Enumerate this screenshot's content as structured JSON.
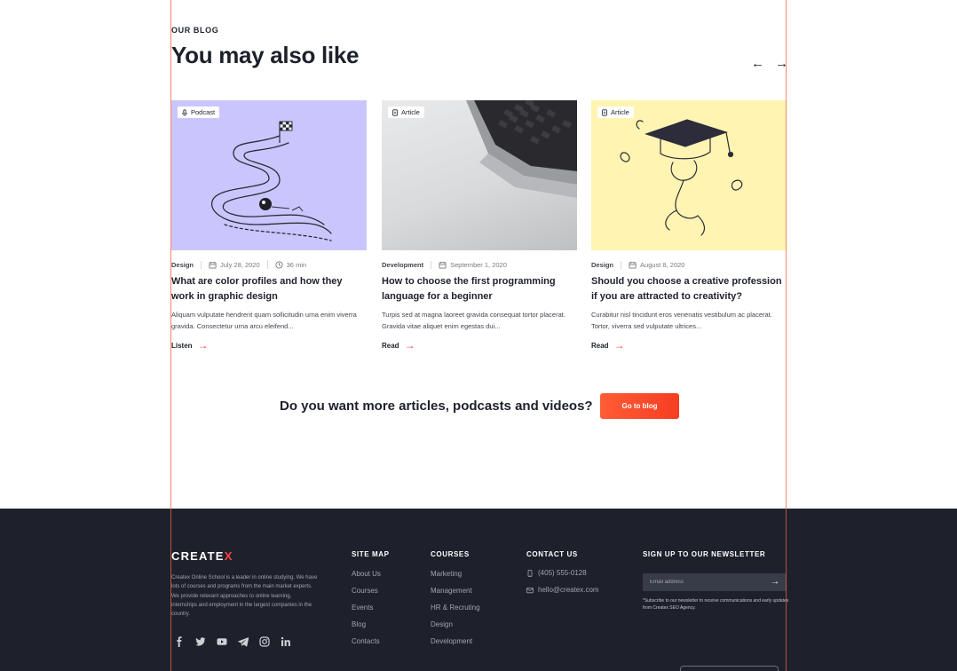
{
  "blog": {
    "eyebrow": "OUR BLOG",
    "heading": "You may also like",
    "prev_icon": "arrow-left-icon",
    "next_icon": "arrow-right-icon"
  },
  "cards": [
    {
      "badge": "Podcast",
      "badge_icon": "microphone-icon",
      "category": "Design",
      "date": "July 28, 2020",
      "duration": "36 min",
      "title": "What are color profiles and how they work in graphic design",
      "excerpt": "Aliquam vulputate hendrerit quam sollicitudin urna enim viverra gravida. Consectetur urna arcu eleifend...",
      "link": "Listen"
    },
    {
      "badge": "Article",
      "badge_icon": "file-icon",
      "category": "Development",
      "date": "September 1, 2020",
      "title": "How to choose the first programming language for a beginner",
      "excerpt": "Turpis sed at magna laoreet gravida consequat tortor placerat. Gravida vitae aliquet enim egestas dui...",
      "link": "Read"
    },
    {
      "badge": "Article",
      "badge_icon": "file-icon",
      "category": "Design",
      "date": "August 8, 2020",
      "title": "Should you choose a creative profession if you are attracted to creativity?",
      "excerpt": "Curabitur nisl tincidunt eros venenatis vestibulum ac placerat. Tortor, viverra sed vulputate ultrices...",
      "link": "Read"
    }
  ],
  "cta": {
    "text": "Do you want more articles, podcasts and videos?",
    "button": "Go to blog"
  },
  "footer": {
    "logo_main": "CREATE",
    "logo_accent": "X",
    "about": "Createx Online School is a leader in online studying. We have lots of courses and programs from the main market experts. We provide relevant approaches to online learning, internships and employment in the largest companies in the country.",
    "socials": [
      "facebook-icon",
      "twitter-icon",
      "youtube-icon",
      "telegram-icon",
      "instagram-icon",
      "linkedin-icon"
    ],
    "sitemap": {
      "title": "SITE MAP",
      "items": [
        "About Us",
        "Courses",
        "Events",
        "Blog",
        "Contacts"
      ]
    },
    "courses": {
      "title": "COURSES",
      "items": [
        "Marketing",
        "Management",
        "HR & Recruting",
        "Design",
        "Development"
      ]
    },
    "contact": {
      "title": "CONTACT US",
      "phone": "(405) 555-0128",
      "email": "hello@createx.com"
    },
    "newsletter": {
      "title": "SIGN UP TO OUR NEWSLETTER",
      "placeholder": "Email address",
      "note": "*Subscribe to our newsletter to receive communications and early updates from Createx SEO Agency."
    }
  },
  "colors": {
    "accent": "#ff4242",
    "dark": "#1e212c",
    "purple_thumb": "#cac6fd",
    "yellow_thumb": "#fff4b2"
  }
}
